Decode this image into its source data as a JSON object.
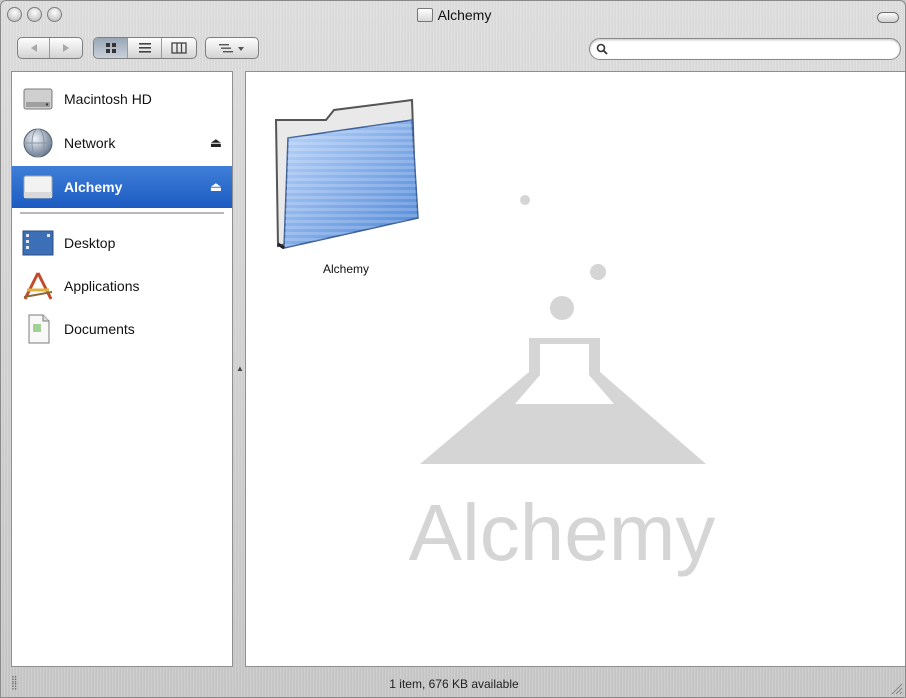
{
  "window": {
    "title": "Alchemy"
  },
  "toolbar": {
    "back_icon": "back-arrow-icon",
    "forward_icon": "forward-arrow-icon",
    "view_icon_label": "icon-view-icon",
    "view_list_label": "list-view-icon",
    "view_column_label": "column-view-icon",
    "active_view": "icon",
    "action_menu_icon": "action-menu-icon"
  },
  "search": {
    "value": "",
    "placeholder": ""
  },
  "sidebar": {
    "devices": [
      {
        "label": "Macintosh HD",
        "icon": "hard-drive-icon",
        "eject": false,
        "selected": false
      },
      {
        "label": "Network",
        "icon": "network-globe-icon",
        "eject": true,
        "selected": false
      },
      {
        "label": "Alchemy",
        "icon": "disk-image-icon",
        "eject": true,
        "selected": true
      }
    ],
    "places": [
      {
        "label": "Desktop",
        "icon": "desktop-icon"
      },
      {
        "label": "Applications",
        "icon": "applications-icon"
      },
      {
        "label": "Documents",
        "icon": "documents-icon"
      }
    ],
    "eject_glyph": "⏏"
  },
  "content": {
    "items": [
      {
        "label": "Alchemy",
        "icon": "folder-icon"
      }
    ],
    "watermark_text": "Alchemy"
  },
  "status": {
    "text": "1 item, 676 KB available"
  },
  "colors": {
    "selection": "#2a6acb",
    "watermark": "#d5d5d5",
    "folder_blue": "#7eaef0"
  }
}
